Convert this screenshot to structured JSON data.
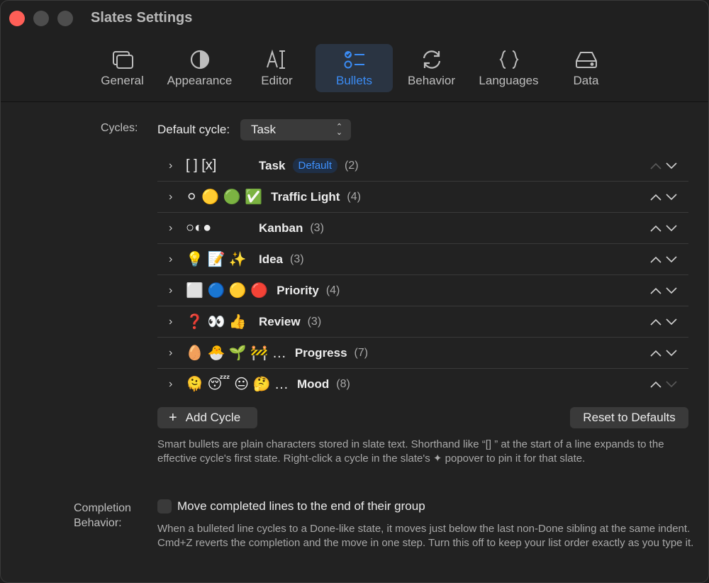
{
  "window": {
    "title": "Slates Settings"
  },
  "tabs": [
    {
      "label": "General",
      "icon": "windows-icon"
    },
    {
      "label": "Appearance",
      "icon": "half-circle-icon"
    },
    {
      "label": "Editor",
      "icon": "text-cursor-icon"
    },
    {
      "label": "Bullets",
      "icon": "bullet-list-icon",
      "active": true
    },
    {
      "label": "Behavior",
      "icon": "refresh-arrows-icon"
    },
    {
      "label": "Languages",
      "icon": "curly-braces-icon"
    },
    {
      "label": "Data",
      "icon": "drive-icon"
    }
  ],
  "cycles": {
    "section_label": "Cycles:",
    "default_label": "Default cycle:",
    "default_value": "Task",
    "items": [
      {
        "bullets": "[ ] [x]",
        "name": "Task",
        "badge": "Default",
        "count": "(2)"
      },
      {
        "bullets": "⚪ 🟡 🟢 ✅",
        "name": "Traffic Light",
        "count": "(4)"
      },
      {
        "bullets": "○◐●",
        "name": "Kanban",
        "count": "(3)"
      },
      {
        "bullets": "💡 📝 ✨",
        "name": "Idea",
        "count": "(3)"
      },
      {
        "bullets": "⬜ 🔵 🟡 🔴",
        "name": "Priority",
        "count": "(4)"
      },
      {
        "bullets": "❓ 👀 👍",
        "name": "Review",
        "count": "(3)"
      },
      {
        "bullets": "🥚 🐣 🌱 🚧 …",
        "name": "Progress",
        "count": "(7)"
      },
      {
        "bullets": "🫠 😴 😐 🤔 …",
        "name": "Mood",
        "count": "(8)"
      }
    ],
    "add_button": "Add Cycle",
    "reset_button": "Reset to Defaults",
    "description": "Smart bullets are plain characters stored in slate text. Shorthand like “[] ” at the start of a line expands to the effective cycle's first state. Right-click a cycle in the slate's ✦ popover to pin it for that slate."
  },
  "completion": {
    "section_label_line1": "Completion",
    "section_label_line2": "Behavior:",
    "checkbox_label": "Move completed lines to the end of their group",
    "checked": false,
    "description": "When a bulleted line cycles to a Done-like state, it moves just below the last non-Done sibling at the same indent. Cmd+Z reverts the completion and the move in one step. Turn this off to keep your list order exactly as you type it."
  },
  "colors": {
    "accent": "#3b8cf5",
    "close": "#ff5f57"
  }
}
